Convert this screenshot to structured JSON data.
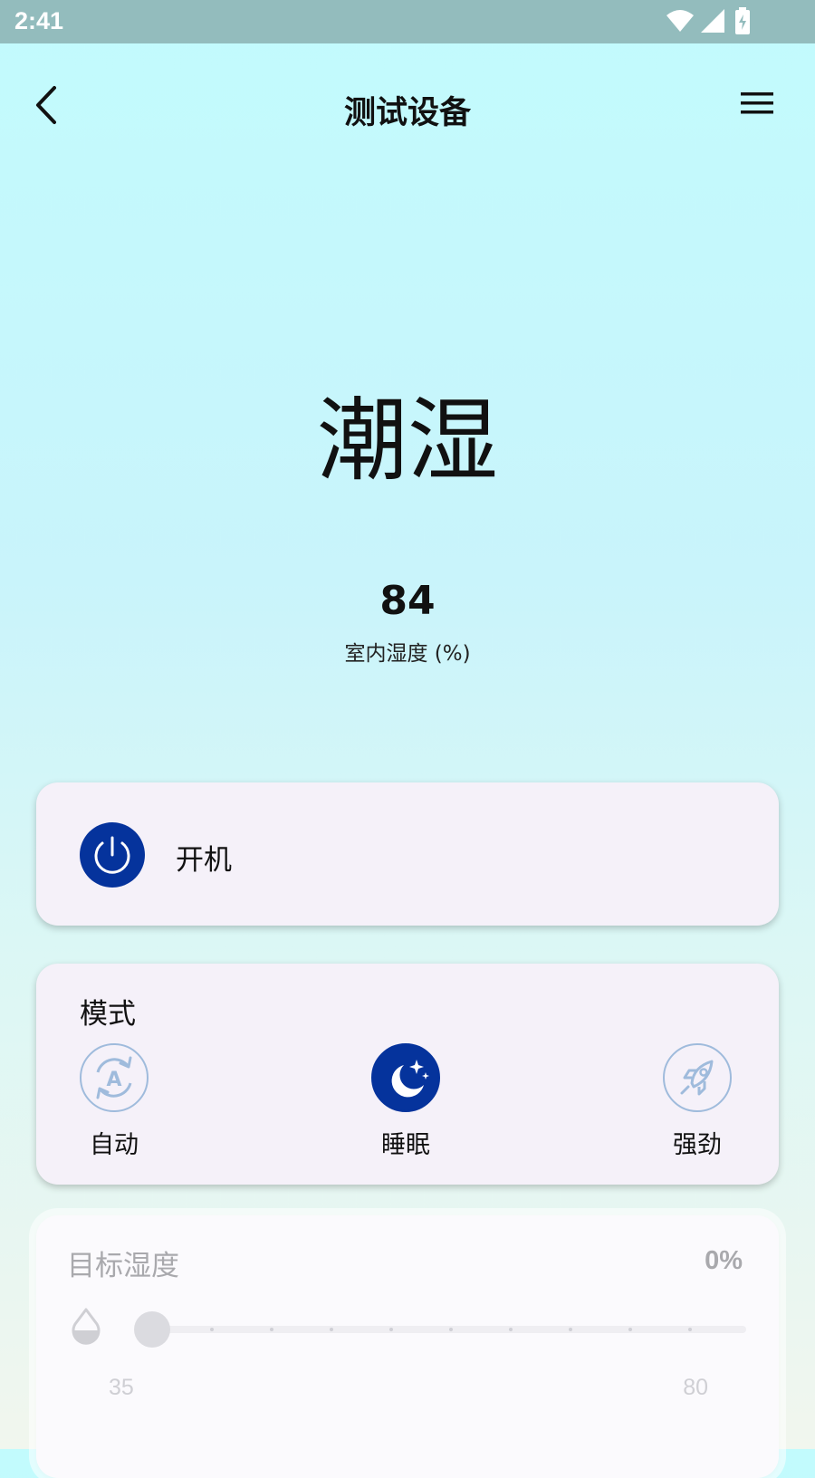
{
  "status_bar": {
    "time": "2:41"
  },
  "header": {
    "title": "测试设备"
  },
  "hero": {
    "status_word": "潮湿",
    "humidity_value": "84",
    "humidity_label": "室内湿度 (%)"
  },
  "power": {
    "label": "开机",
    "icon": "power-icon",
    "state_color": "#05339c"
  },
  "mode": {
    "title": "模式",
    "items": [
      {
        "label": "自动",
        "icon": "auto-mode-icon",
        "selected": false
      },
      {
        "label": "睡眠",
        "icon": "moon-stars-icon",
        "selected": true
      },
      {
        "label": "强劲",
        "icon": "rocket-icon",
        "selected": false
      }
    ]
  },
  "target_humidity": {
    "title": "目标湿度",
    "value": "0%",
    "slider_min": "35",
    "slider_max": "80",
    "slider_level": 0,
    "enabled": false
  },
  "colors": {
    "accent": "#05339c",
    "inactive_border": "#9fbbdc",
    "disabled_text": "#a9a9ad"
  }
}
